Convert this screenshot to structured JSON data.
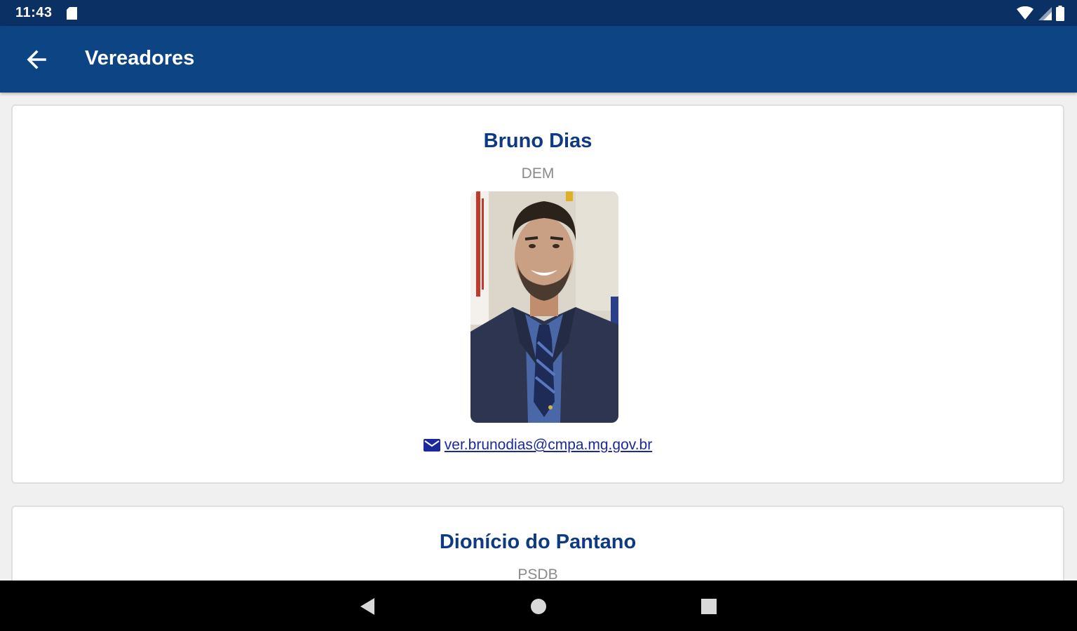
{
  "status_bar": {
    "time": "11:43",
    "icons": [
      "sd-card-icon",
      "wifi-icon",
      "signal-icon",
      "battery-icon"
    ]
  },
  "app_bar": {
    "title": "Vereadores",
    "back_icon": "arrow-back-icon"
  },
  "colors": {
    "status_bar": "#0a3064",
    "app_bar": "#0d4484",
    "name_text": "#0d3a80",
    "link_text": "#1a2a9a",
    "party_text": "#8a8a8a",
    "background": "#f0f0f0"
  },
  "councillors": [
    {
      "name": "Bruno Dias",
      "party": "DEM",
      "photo": "portrait-photo",
      "email": "ver.brunodias@cmpa.mg.gov.br",
      "email_icon": "envelope-icon"
    },
    {
      "name": "Dionício do Pantano",
      "party": "PSDB"
    }
  ],
  "nav_bar": {
    "icons": [
      "nav-back-icon",
      "nav-home-icon",
      "nav-recents-icon"
    ]
  }
}
